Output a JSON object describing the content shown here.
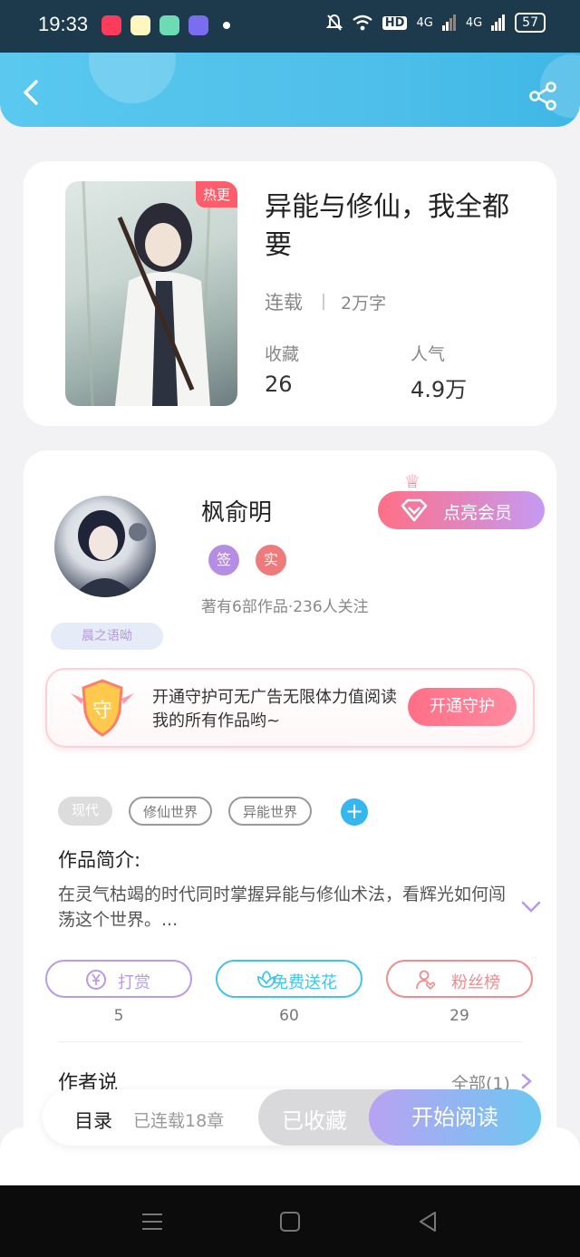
{
  "status_bar": {
    "time": "19:33",
    "battery": "57",
    "network_1": "4G",
    "network_2": "4G",
    "hd": "HD"
  },
  "book": {
    "badge": "热更",
    "title": "异能与修仙，我全都要",
    "status": "连载",
    "word_count": "2万字",
    "favorites_label": "收藏",
    "favorites_value": "26",
    "popularity_label": "人气",
    "popularity_value": "4.9万"
  },
  "author": {
    "name": "枫俞明",
    "vip_button": "点亮会员",
    "badges": [
      "签",
      "实"
    ],
    "stats": "著有6部作品·236人关注",
    "nickname_tag": "晨之语呦"
  },
  "guard": {
    "shield_char": "守",
    "text": "开通守护可无广告无限体力值阅读我的所有作品哟~",
    "button": "开通守护"
  },
  "tags": [
    "现代",
    "修仙世界",
    "异能世界"
  ],
  "tag_add": "+",
  "intro": {
    "title": "作品简介:",
    "text": "在灵气枯竭的时代同时掌握异能与修仙术法，看辉光如何闯荡这个世界。..."
  },
  "actions": [
    {
      "label": "打赏",
      "count": "5",
      "color": "#b99ae6"
    },
    {
      "label": "免费送花",
      "count": "60",
      "color": "#42c3e9"
    },
    {
      "label": "粉丝榜",
      "count": "29",
      "color": "#ef8c8f"
    }
  ],
  "author_says": {
    "title": "作者说",
    "all_label": "全部(1)"
  },
  "bottom_bar": {
    "toc": "目录",
    "chapters": "已连载18章",
    "favorited": "已收藏",
    "start_reading": "开始阅读"
  },
  "colors": {
    "header": "#4fc0ea",
    "accent_pink": "#ff6f86",
    "accent_purple": "#c59af3"
  }
}
